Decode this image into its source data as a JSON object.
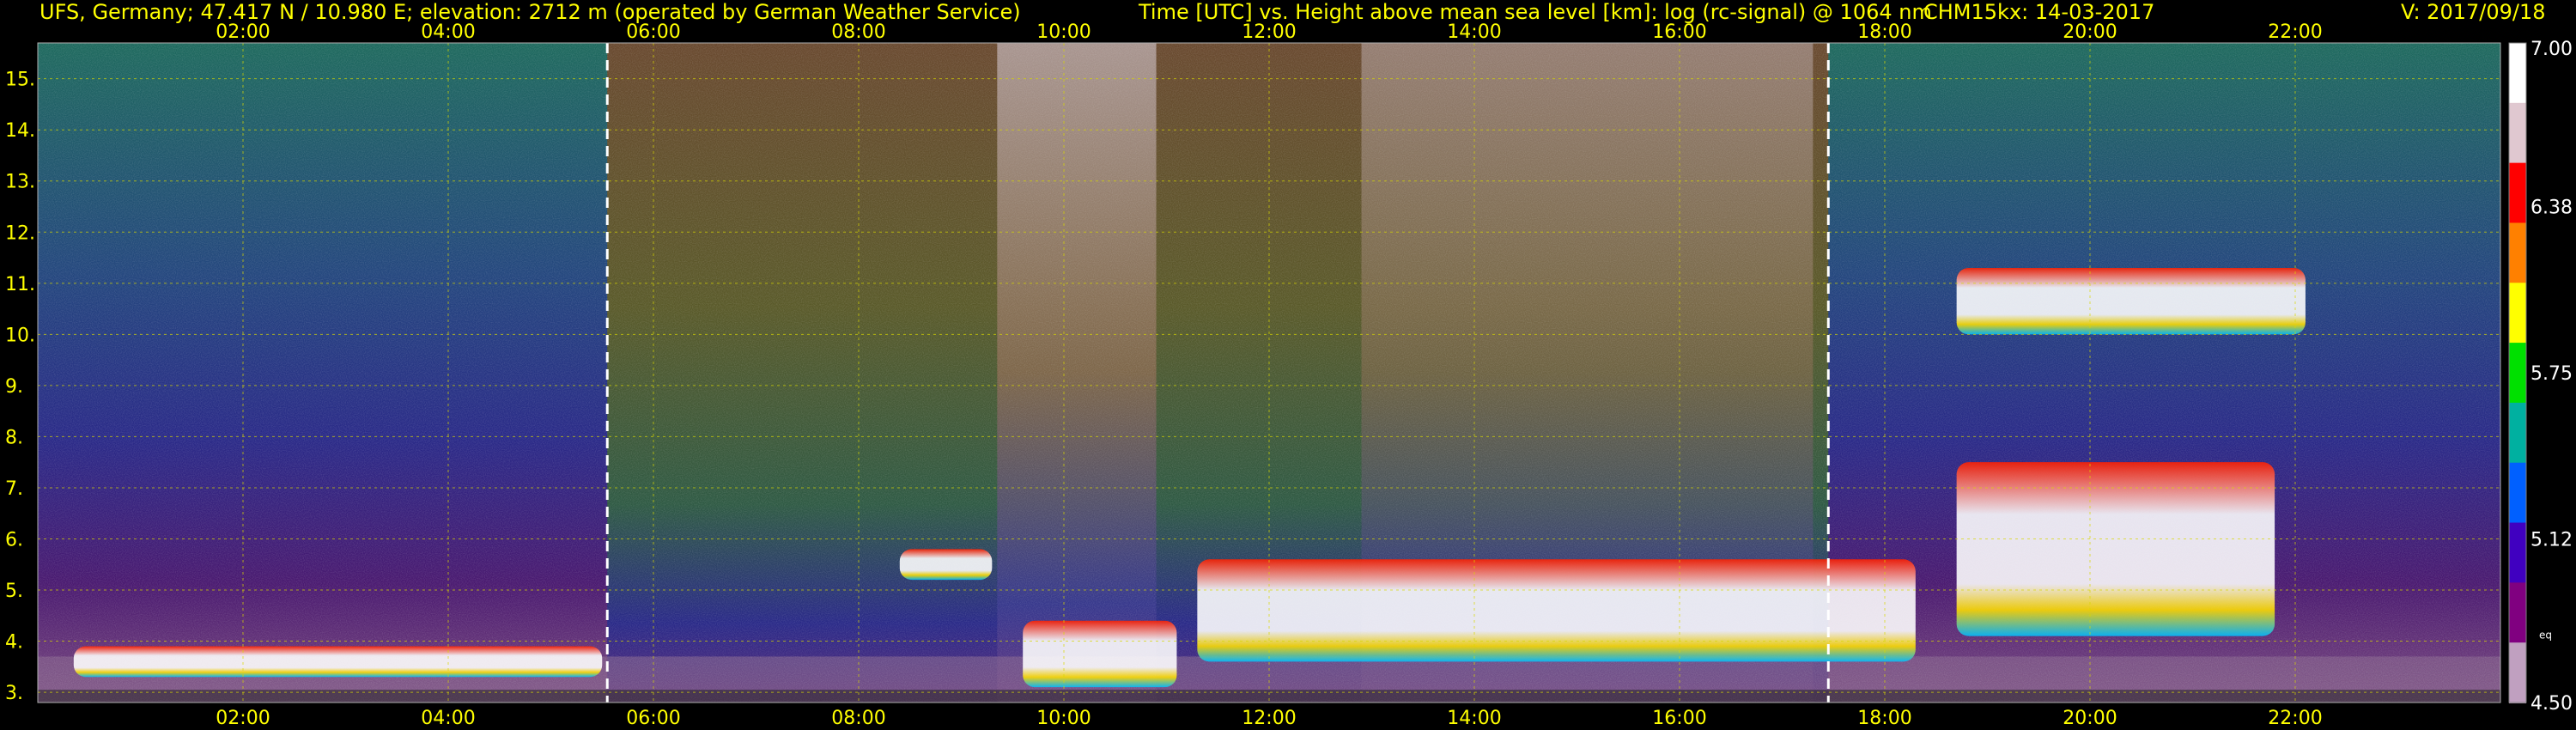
{
  "header": {
    "site": "UFS, Germany; 47.417 N / 10.980 E; elevation: 2712 m  (operated by German Weather Service)",
    "axis_title": "Time [UTC] vs. Height above mean sea level [km]: log (rc-signal) @ 1064 nm",
    "instrument_date": "CHM15kx: 14-03-2017",
    "version": "V: 2017/09/18"
  },
  "chart_data": {
    "type": "heatmap",
    "x_unit": "Time [UTC]",
    "x_range_hours": [
      0.0,
      24.0
    ],
    "x_ticks": [
      "02:00",
      "04:00",
      "06:00",
      "08:00",
      "10:00",
      "12:00",
      "14:00",
      "16:00",
      "18:00",
      "20:00",
      "22:00"
    ],
    "x_tick_hours": [
      2,
      4,
      6,
      8,
      10,
      12,
      14,
      16,
      18,
      20,
      22
    ],
    "y_unit": "Height above mean sea level [km]",
    "y_range_km": [
      2.8,
      15.7
    ],
    "y_ticks": [
      "3.",
      "4.",
      "5.",
      "6.",
      "7.",
      "8.",
      "9.",
      "10.",
      "11.",
      "12.",
      "13.",
      "14.",
      "15."
    ],
    "y_tick_values": [
      3,
      4,
      5,
      6,
      7,
      8,
      9,
      10,
      11,
      12,
      13,
      14,
      15
    ],
    "grid": true,
    "colorbar": {
      "quantity": "log (rc-signal)",
      "range": [
        4.5,
        7.0
      ],
      "tick_labels": [
        "4.50",
        "5.12",
        "5.75",
        "6.38",
        "7.00"
      ],
      "tick_values": [
        4.5,
        5.12,
        5.75,
        6.38,
        7.0
      ],
      "unit_label": "eq",
      "colors": [
        "#ffffff",
        "#e0c8d0",
        "#ff0000",
        "#ff8000",
        "#ffff00",
        "#00e000",
        "#00b0a0",
        "#0060ff",
        "#4000c0",
        "#800080",
        "#c0a0c0"
      ]
    },
    "markers_hours": [
      5.55,
      17.45
    ],
    "cloud_layers": [
      {
        "start_hour": 0.35,
        "end_hour": 5.5,
        "base_km": 3.3,
        "top_km": 3.9
      },
      {
        "start_hour": 8.4,
        "end_hour": 9.3,
        "base_km": 5.2,
        "top_km": 5.8
      },
      {
        "start_hour": 9.6,
        "end_hour": 11.1,
        "base_km": 3.1,
        "top_km": 4.4
      },
      {
        "start_hour": 11.3,
        "end_hour": 18.3,
        "base_km": 3.6,
        "top_km": 5.6
      },
      {
        "start_hour": 18.7,
        "end_hour": 21.8,
        "base_km": 4.1,
        "top_km": 7.5
      },
      {
        "start_hour": 18.7,
        "end_hour": 22.1,
        "base_km": 10.0,
        "top_km": 11.3
      }
    ]
  }
}
